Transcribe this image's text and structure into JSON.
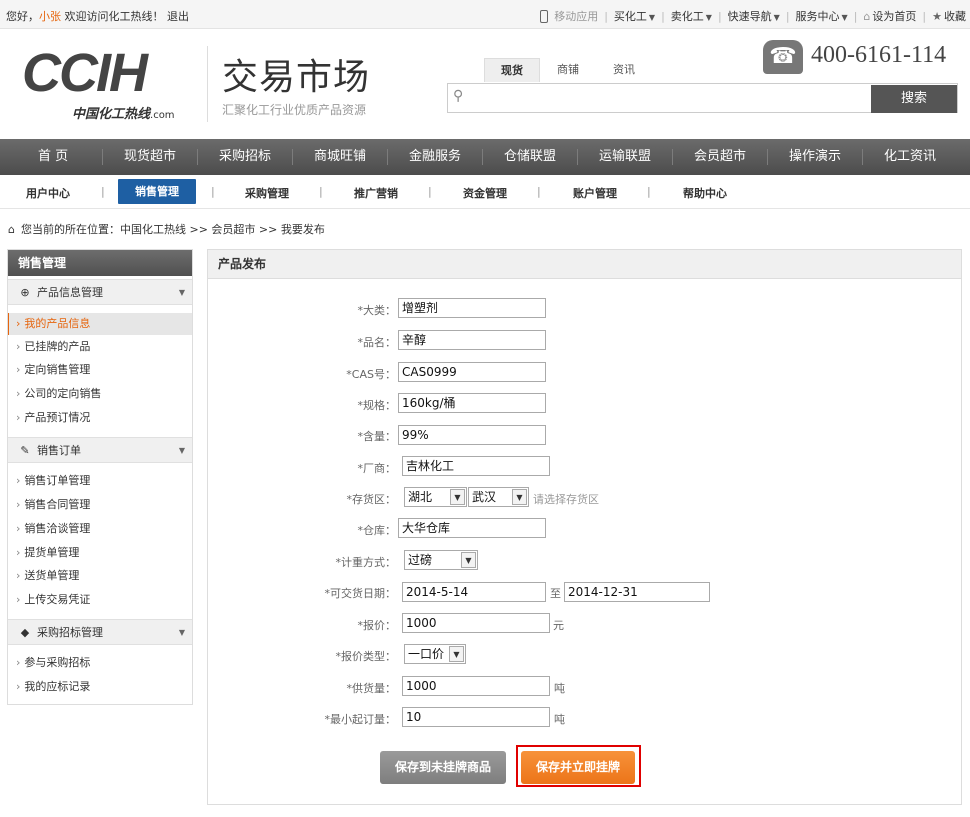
{
  "topbar": {
    "greeting_prefix": "您好，",
    "username": "小张",
    "welcome": " 欢迎访问化工热线！",
    "logout": "退出",
    "links": [
      {
        "label": "移动应用",
        "icon": "mobile-icon",
        "dropdown": false
      },
      {
        "label": "买化工",
        "dropdown": true
      },
      {
        "label": "卖化工",
        "dropdown": true
      },
      {
        "label": "快速导航",
        "dropdown": true
      },
      {
        "label": "服务中心",
        "dropdown": true
      },
      {
        "label": "设为首页",
        "icon": "home-icon",
        "dropdown": false
      },
      {
        "label": "收藏",
        "icon": "star-icon",
        "dropdown": false
      }
    ]
  },
  "header": {
    "logo_text": "CCIH",
    "logo_sub": "中国化工热线",
    "logo_domain": ".com",
    "market_title": "交易市场",
    "market_subtitle": "汇聚化工行业优质产品资源",
    "search_tabs": [
      "现货",
      "商铺",
      "资讯"
    ],
    "active_search_tab": "现货",
    "search_placeholder": "",
    "search_button": "搜索",
    "phone": "400-6161-114"
  },
  "main_nav": [
    "首 页",
    "现货超市",
    "采购招标",
    "商城旺铺",
    "金融服务",
    "仓储联盟",
    "运输联盟",
    "会员超市",
    "操作演示",
    "化工资讯"
  ],
  "sub_nav": {
    "items": [
      "用户中心",
      "销售管理",
      "采购管理",
      "推广营销",
      "资金管理",
      "账户管理",
      "帮助中心"
    ],
    "active": "销售管理"
  },
  "breadcrumb": {
    "prefix": "您当前的所在位置：",
    "path": "中国化工热线 >> 会员超市 >> 我要发布"
  },
  "sidebar": {
    "title": "销售管理",
    "groups": [
      {
        "label": "产品信息管理",
        "icon": "product-icon",
        "items": [
          "我的产品信息",
          "已挂牌的产品",
          "定向销售管理",
          "公司的定向销售",
          "产品预订情况"
        ]
      },
      {
        "label": "销售订单",
        "icon": "edit-icon",
        "items": [
          "销售订单管理",
          "销售合同管理",
          "销售洽谈管理",
          "提货单管理",
          "送货单管理",
          "上传交易凭证"
        ]
      },
      {
        "label": "采购招标管理",
        "icon": "tag-icon",
        "items": [
          "参与采购招标",
          "我的应标记录"
        ]
      }
    ],
    "active_item": "我的产品信息"
  },
  "form": {
    "title": "产品发布",
    "fields": {
      "category": {
        "label": "*大类：",
        "value": "增塑剂"
      },
      "product_name": {
        "label": "*品名：",
        "value": "辛醇"
      },
      "cas": {
        "label": "*CAS号：",
        "value": "CAS0999"
      },
      "spec": {
        "label": "*规格：",
        "value": "160kg/桶"
      },
      "content": {
        "label": "*含量：",
        "value": "99%"
      },
      "manufacturer": {
        "label": "*厂商：",
        "value": "吉林化工"
      },
      "storage_area": {
        "label": "*存货区：",
        "province": "湖北",
        "city": "武汉",
        "hint": "请选择存货区"
      },
      "warehouse": {
        "label": "*仓库：",
        "value": "大华仓库"
      },
      "weigh_method": {
        "label": "*计重方式：",
        "value": "过磅"
      },
      "delivery_date": {
        "label": "*可交货日期：",
        "from": "2014-5-14",
        "to_label": "至",
        "to": "2014-12-31"
      },
      "price": {
        "label": "*报价：",
        "value": "1000",
        "unit": "元"
      },
      "price_type": {
        "label": "*报价类型：",
        "value": "一口价"
      },
      "supply": {
        "label": "*供货量：",
        "value": "1000",
        "unit": "吨"
      },
      "min_order": {
        "label": "*最小起订量：",
        "value": "10",
        "unit": "吨"
      }
    },
    "buttons": {
      "save_unlisted": "保存到未挂牌商品",
      "save_list": "保存并立即挂牌"
    }
  },
  "colors": {
    "accent_orange": "#ec7419",
    "active_blue": "#1e5fa3",
    "highlight_red": "#e00000",
    "nav_gray": "#555555"
  }
}
